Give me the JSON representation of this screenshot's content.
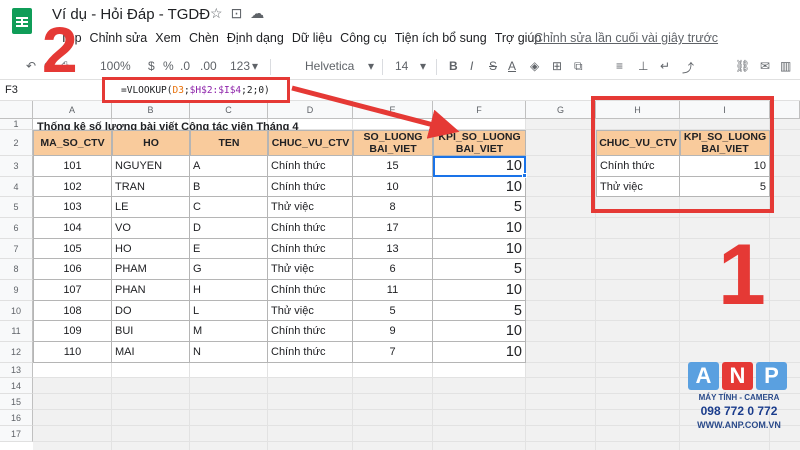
{
  "window": {
    "doc_title": "Ví dụ - Hỏi Đáp - TGDĐ",
    "title_icons": [
      "star-icon",
      "move-to-folder-icon",
      "cloud-saved-icon"
    ]
  },
  "menu": {
    "items": [
      "Tệp",
      "Chỉnh sửa",
      "Xem",
      "Chèn",
      "Định dạng",
      "Dữ liệu",
      "Công cụ",
      "Tiện ích bổ sung",
      "Trợ giúp"
    ],
    "last_edit": "Chỉnh sửa lần cuối vài giây trước"
  },
  "toolbar": {
    "zoom": "100%",
    "currency": "$",
    "percent": "%",
    "decimal_less": ".0",
    "decimal_more": ".00",
    "more_formats": "123",
    "font": "Helvetica",
    "font_size": "14",
    "bold": "B",
    "italic": "I",
    "strike": "S",
    "text_color": "A"
  },
  "formula": {
    "cell_ref": "F3",
    "prefix": "=VLOOKUP(",
    "ref1": "D3",
    "middle": ";",
    "ref2": "$H$2:$I$4",
    "suffix": ";2;0)"
  },
  "grid": {
    "columns": [
      "A",
      "B",
      "C",
      "D",
      "E",
      "F",
      "G",
      "H",
      "I"
    ],
    "rows": [
      "1",
      "2",
      "3",
      "4",
      "5",
      "6",
      "7",
      "8",
      "9",
      "10",
      "11",
      "12",
      "13",
      "14",
      "15",
      "16",
      "17"
    ]
  },
  "sheet": {
    "title": "Thống kê số lượng bài viết Cộng tác viên Tháng 4",
    "headers": [
      "MA_SO_CTV",
      "HO",
      "TEN",
      "CHUC_VU_CTV",
      "SO_LUONG BAI_VIET",
      "KPI_SO_LUONG BAI_VIET"
    ],
    "rows": [
      [
        "101",
        "NGUYEN",
        "A",
        "Chính thức",
        "15",
        "10"
      ],
      [
        "102",
        "TRAN",
        "B",
        "Chính thức",
        "10",
        "10"
      ],
      [
        "103",
        "LE",
        "C",
        "Thử việc",
        "8",
        "5"
      ],
      [
        "104",
        "VO",
        "D",
        "Chính thức",
        "17",
        "10"
      ],
      [
        "105",
        "HO",
        "E",
        "Chính thức",
        "13",
        "10"
      ],
      [
        "106",
        "PHAM",
        "G",
        "Thử việc",
        "6",
        "5"
      ],
      [
        "107",
        "PHAN",
        "H",
        "Chính thức",
        "11",
        "10"
      ],
      [
        "108",
        "DO",
        "L",
        "Thử việc",
        "5",
        "5"
      ],
      [
        "109",
        "BUI",
        "M",
        "Chính thức",
        "9",
        "10"
      ],
      [
        "110",
        "MAI",
        "N",
        "Chính thức",
        "7",
        "10"
      ]
    ]
  },
  "lookup": {
    "headers": [
      "CHUC_VU_CTV",
      "KPI_SO_LUONG BAI_VIET"
    ],
    "rows": [
      [
        "Chính thức",
        "10"
      ],
      [
        "Thử việc",
        "5"
      ]
    ]
  },
  "annotations": {
    "step1": "1",
    "step2": "2"
  },
  "watermark": {
    "letters": [
      "A",
      "N",
      "P"
    ],
    "line1": "MÁY TÍNH - CAMERA",
    "line2": "098 772 0 772",
    "line3": "WWW.ANP.COM.VN"
  },
  "colors": {
    "header_fill": "#f9cb9c",
    "annotation_red": "#e53935",
    "selection_blue": "#1a73e8",
    "sheets_green": "#0f9d58"
  }
}
